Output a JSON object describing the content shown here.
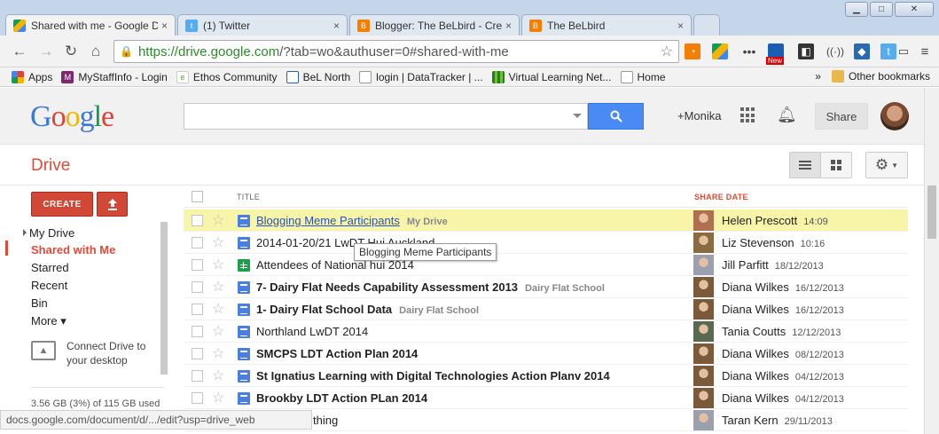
{
  "window": {
    "minimize": "▁",
    "maximize": "□",
    "close": "✕"
  },
  "tabs": [
    {
      "label": "Shared with me - Google D",
      "favicon": "drive-icon",
      "close": "×",
      "active": true
    },
    {
      "label": "(1) Twitter",
      "favicon": "twitter-icon",
      "close": "×",
      "active": false
    },
    {
      "label": "Blogger: The BeLbird - Cre",
      "favicon": "blogger-icon",
      "close": "×",
      "active": false
    },
    {
      "label": "The BeLbird",
      "favicon": "blogger-icon",
      "close": "×",
      "active": false
    }
  ],
  "toolbar": {
    "url_host": "https://drive.google.com",
    "url_rest": "/?tab=wo&authuser=0#shared-with-me",
    "extension_badge": "New"
  },
  "bookmarks": [
    {
      "label": "Apps",
      "icon": "apps-grid-icon"
    },
    {
      "label": "MyStaffInfo - Login",
      "icon": "m-logo-icon"
    },
    {
      "label": "Ethos Community",
      "icon": "ethos-icon"
    },
    {
      "label": "BeL North",
      "icon": "page-icon"
    },
    {
      "label": "login | DataTracker | ...",
      "icon": "page-icon"
    },
    {
      "label": "Virtual Learning Net...",
      "icon": "vln-icon"
    },
    {
      "label": "Home",
      "icon": "page-icon"
    }
  ],
  "bookmarks_overflow": "»",
  "other_bookmarks": "Other bookmarks",
  "google": {
    "logo": [
      "G",
      "o",
      "o",
      "g",
      "l",
      "e"
    ],
    "search_placeholder": "",
    "user_link": "+Monika",
    "share_label": "Share"
  },
  "drive": {
    "title": "Drive",
    "create_label": "CREATE",
    "nav": [
      {
        "label": "My Drive",
        "active": false
      },
      {
        "label": "Shared with Me",
        "active": true
      },
      {
        "label": "Starred",
        "active": false
      },
      {
        "label": "Recent",
        "active": false
      },
      {
        "label": "Bin",
        "active": false
      },
      {
        "label": "More ▾",
        "active": false
      }
    ],
    "connect_text": "Connect Drive to your desktop",
    "storage": "3.56 GB (3%) of 115 GB used"
  },
  "list": {
    "header_title": "TITLE",
    "header_share_date": "SHARE DATE",
    "rows": [
      {
        "name": "Blogging Meme Participants",
        "location": "My Drive",
        "type": "doc",
        "bold": false,
        "link": true,
        "highlight": true,
        "sharer": "Helen Prescott",
        "date": "14:09",
        "avatar": "#b07050"
      },
      {
        "name": "2014-01-20/21 LwDT Hui Auckland",
        "location": "",
        "type": "doc",
        "bold": false,
        "link": false,
        "highlight": false,
        "sharer": "Liz Stevenson",
        "date": "10:16",
        "avatar": "#8a6a40"
      },
      {
        "name": "Attendees of National hui 2014",
        "location": "",
        "type": "sheet",
        "bold": false,
        "link": false,
        "highlight": false,
        "sharer": "Jill Parfitt",
        "date": "18/12/2013",
        "avatar": "#9aa0ad"
      },
      {
        "name": "7- Dairy Flat Needs Capability Assessment 2013",
        "location": "Dairy Flat School",
        "type": "doc",
        "bold": true,
        "link": false,
        "highlight": false,
        "sharer": "Diana Wilkes",
        "date": "16/12/2013",
        "avatar": "#7a5a3a"
      },
      {
        "name": "1- Dairy Flat School Data",
        "location": "Dairy Flat School",
        "type": "doc",
        "bold": true,
        "link": false,
        "highlight": false,
        "sharer": "Diana Wilkes",
        "date": "16/12/2013",
        "avatar": "#7a5a3a"
      },
      {
        "name": "Northland LwDT 2014",
        "location": "",
        "type": "doc",
        "bold": false,
        "link": false,
        "highlight": false,
        "sharer": "Tania Coutts",
        "date": "12/12/2013",
        "avatar": "#5a6a50"
      },
      {
        "name": "SMCPS LDT Action Plan 2014",
        "location": "",
        "type": "doc",
        "bold": true,
        "link": false,
        "highlight": false,
        "sharer": "Diana Wilkes",
        "date": "08/12/2013",
        "avatar": "#7a5a3a"
      },
      {
        "name": "St Ignatius Learning with Digital Technologies Action Planv 2014",
        "location": "",
        "type": "doc",
        "bold": true,
        "link": false,
        "highlight": false,
        "sharer": "Diana Wilkes",
        "date": "04/12/2013",
        "avatar": "#7a5a3a"
      },
      {
        "name": "Brookby LDT Action PLan 2014",
        "location": "",
        "type": "doc",
        "bold": true,
        "link": false,
        "highlight": false,
        "sharer": "Diana Wilkes",
        "date": "04/12/2013",
        "avatar": "#7a5a3a"
      },
      {
        "name": "thing",
        "location": "",
        "type": "doc",
        "bold": false,
        "link": false,
        "highlight": false,
        "sharer": "Taran Kern",
        "date": "29/11/2013",
        "avatar": "#9aa0ad"
      }
    ]
  },
  "tooltip": "Blogging Meme Participants",
  "statusbar": "docs.google.com/document/d/.../edit?usp=drive_web",
  "colors": {
    "accent_red": "#dd4b39",
    "search_blue": "#4a8af4",
    "highlight": "#f8f5a8"
  }
}
